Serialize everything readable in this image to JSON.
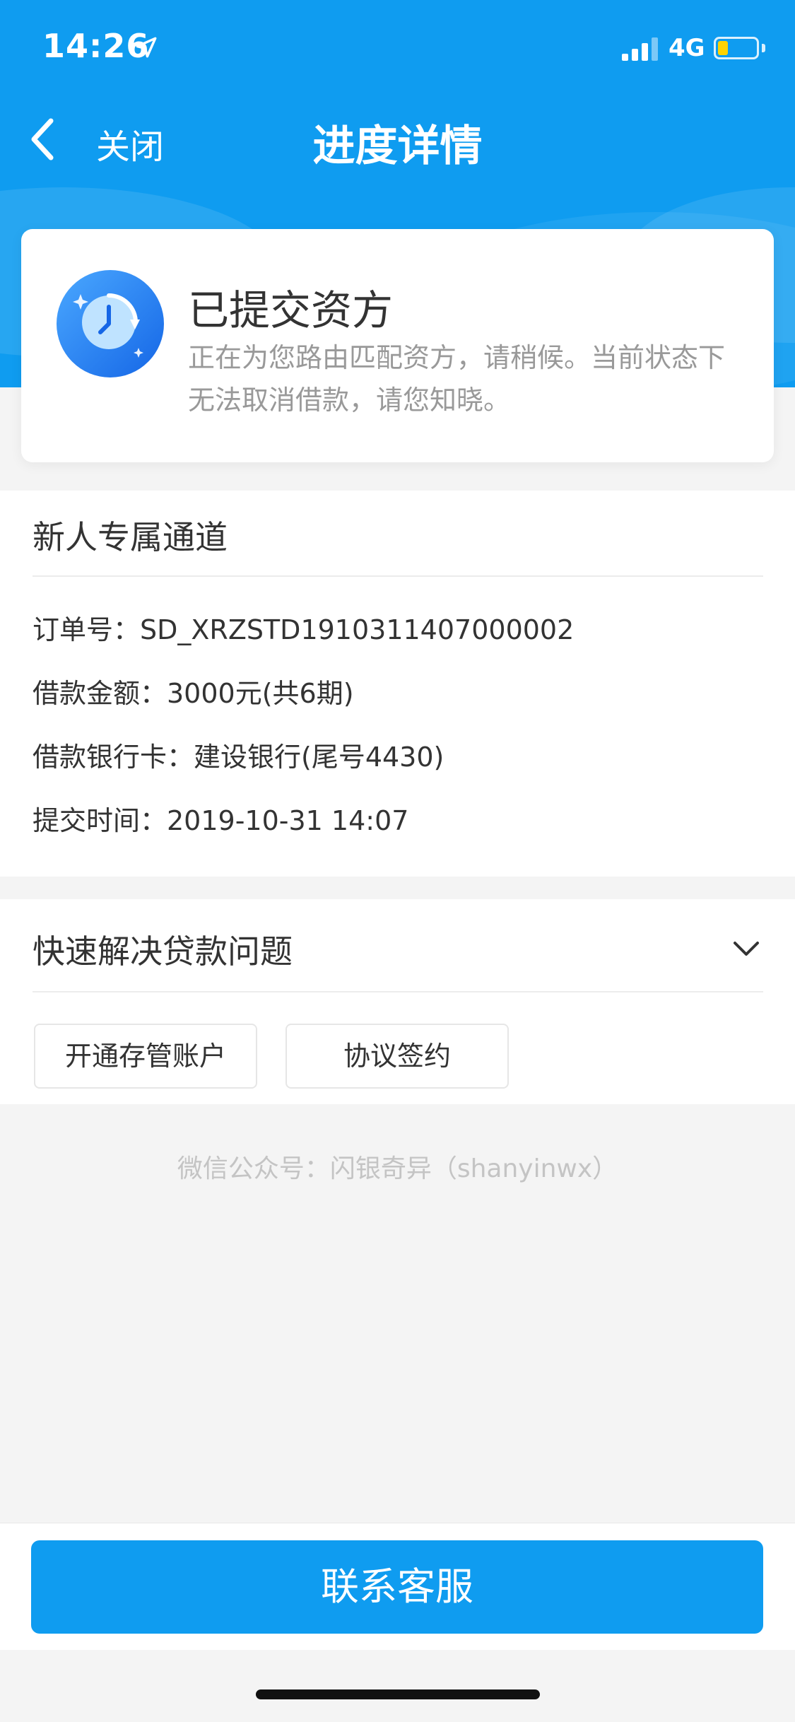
{
  "status_bar": {
    "time": "14:26",
    "network": "4G"
  },
  "nav": {
    "close_label": "关闭",
    "title": "进度详情"
  },
  "status_card": {
    "title": "已提交资方",
    "description": "正在为您路由匹配资方，请稍候。当前状态下无法取消借款，请您知晓。"
  },
  "order": {
    "product_name": "新人专属通道",
    "rows": [
      "订单号：SD_XRZSTD1910311407000002",
      "借款金额：3000元(共6期)",
      "借款银行卡：建设银行(尾号4430)",
      "提交时间：2019-10-31 14:07"
    ]
  },
  "quick": {
    "title": "快速解决贷款问题",
    "chips": [
      "开通存管账户",
      "协议签约"
    ]
  },
  "footer_note": "微信公众号：闪银奇异（shanyinwx）",
  "contact_button": "联系客服",
  "colors": {
    "primary": "#0f9cf0",
    "battery": "#ffd300"
  }
}
